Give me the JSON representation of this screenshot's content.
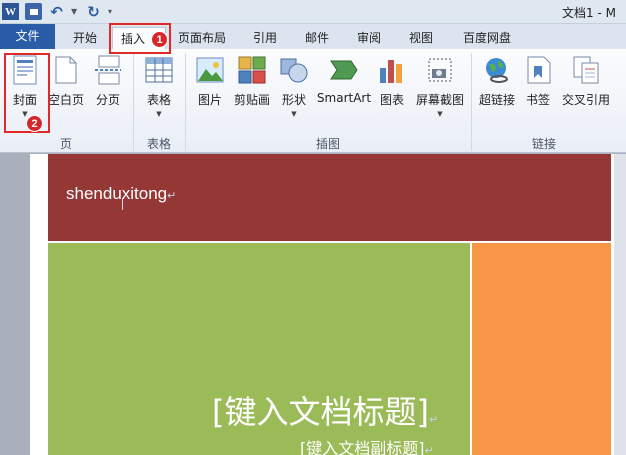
{
  "titlebar": {
    "qat_logo": "W",
    "undo": "↶",
    "redo": "↻",
    "doc_title": "文档1 - M"
  },
  "tabs": [
    {
      "label": "文件"
    },
    {
      "label": "开始"
    },
    {
      "label": "插入"
    },
    {
      "label": "页面布局"
    },
    {
      "label": "引用"
    },
    {
      "label": "邮件"
    },
    {
      "label": "审阅"
    },
    {
      "label": "视图"
    },
    {
      "label": "百度网盘"
    }
  ],
  "ribbon": {
    "buttons": {
      "cover": "封面",
      "blank_page": "空白页",
      "page_break": "分页",
      "table": "表格",
      "picture": "图片",
      "clip_art": "剪贴画",
      "shapes": "形状",
      "smartart": "SmartArt",
      "chart": "图表",
      "screenshot": "屏幕截图",
      "hyperlink": "超链接",
      "bookmark": "书签",
      "cross_ref": "交叉引用"
    },
    "groups": {
      "pages": "页",
      "tables": "表格",
      "illustrations": "插图",
      "links": "链接"
    }
  },
  "annotations": {
    "badge1": "1",
    "badge2": "2",
    "color": "#e02a2a"
  },
  "document": {
    "header_text": "shenduxitong",
    "title_placeholder": "[键入文档标题]",
    "subtitle_placeholder": "[键入文档副标题]",
    "para_mark": "↵",
    "colors": {
      "header_band": "#953735",
      "green": "#9bbb59",
      "orange": "#f79646"
    }
  }
}
